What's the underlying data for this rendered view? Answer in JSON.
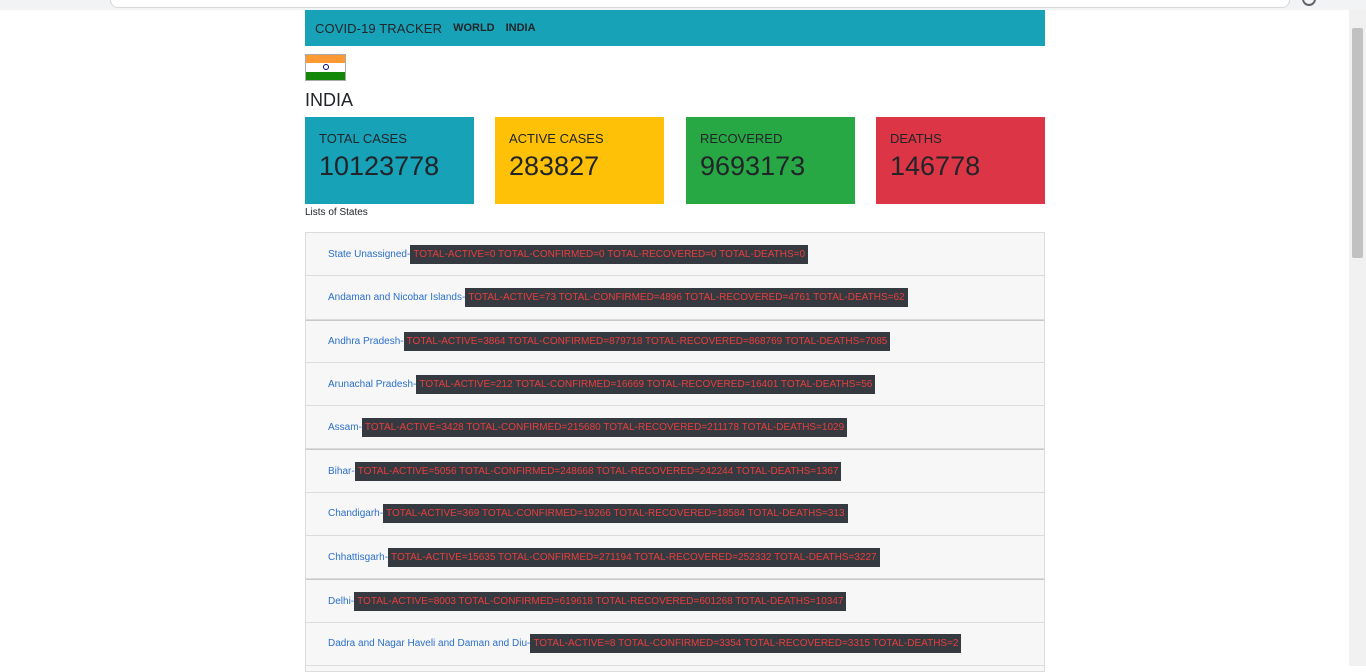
{
  "navbar": {
    "brand": "COVID-19 TRACKER",
    "links": [
      "WORLD",
      "INDIA"
    ]
  },
  "country": {
    "name": "INDIA",
    "flag_icon": "india-flag-icon"
  },
  "cards": [
    {
      "label": "TOTAL CASES",
      "value": "10123778",
      "color": "#17a2b8"
    },
    {
      "label": "ACTIVE CASES",
      "value": "283827",
      "color": "#ffc107"
    },
    {
      "label": "RECOVERED",
      "value": "9693173",
      "color": "#28a745"
    },
    {
      "label": "DEATHS",
      "value": "146778",
      "color": "#dc3545"
    }
  ],
  "states_title": "Lists of States",
  "states": [
    {
      "name": "State Unassigned-",
      "stats": "TOTAL-ACTIVE=0 TOTAL-CONFIRMED=0 TOTAL-RECOVERED=0 TOTAL-DEATHS=0"
    },
    {
      "name": "Andaman and Nicobar Islands-",
      "stats": "TOTAL-ACTIVE=73 TOTAL-CONFIRMED=4896 TOTAL-RECOVERED=4761 TOTAL-DEATHS=62"
    },
    {
      "name": "Andhra Pradesh-",
      "stats": "TOTAL-ACTIVE=3864 TOTAL-CONFIRMED=879718 TOTAL-RECOVERED=868769 TOTAL-DEATHS=7085"
    },
    {
      "name": "Arunachal Pradesh-",
      "stats": "TOTAL-ACTIVE=212 TOTAL-CONFIRMED=16669 TOTAL-RECOVERED=16401 TOTAL-DEATHS=56"
    },
    {
      "name": "Assam-",
      "stats": "TOTAL-ACTIVE=3428 TOTAL-CONFIRMED=215680 TOTAL-RECOVERED=211178 TOTAL-DEATHS=1029"
    },
    {
      "name": "Bihar-",
      "stats": "TOTAL-ACTIVE=5056 TOTAL-CONFIRMED=248668 TOTAL-RECOVERED=242244 TOTAL-DEATHS=1367"
    },
    {
      "name": "Chandigarh-",
      "stats": "TOTAL-ACTIVE=369 TOTAL-CONFIRMED=19266 TOTAL-RECOVERED=18584 TOTAL-DEATHS=313"
    },
    {
      "name": "Chhattisgarh-",
      "stats": "TOTAL-ACTIVE=15635 TOTAL-CONFIRMED=271194 TOTAL-RECOVERED=252332 TOTAL-DEATHS=3227"
    },
    {
      "name": "Delhi-",
      "stats": "TOTAL-ACTIVE=8003 TOTAL-CONFIRMED=619618 TOTAL-RECOVERED=601268 TOTAL-DEATHS=10347"
    },
    {
      "name": "Dadra and Nagar Haveli and Daman and Diu-",
      "stats": "TOTAL-ACTIVE=8 TOTAL-CONFIRMED=3354 TOTAL-RECOVERED=3315 TOTAL-DEATHS=2"
    }
  ]
}
